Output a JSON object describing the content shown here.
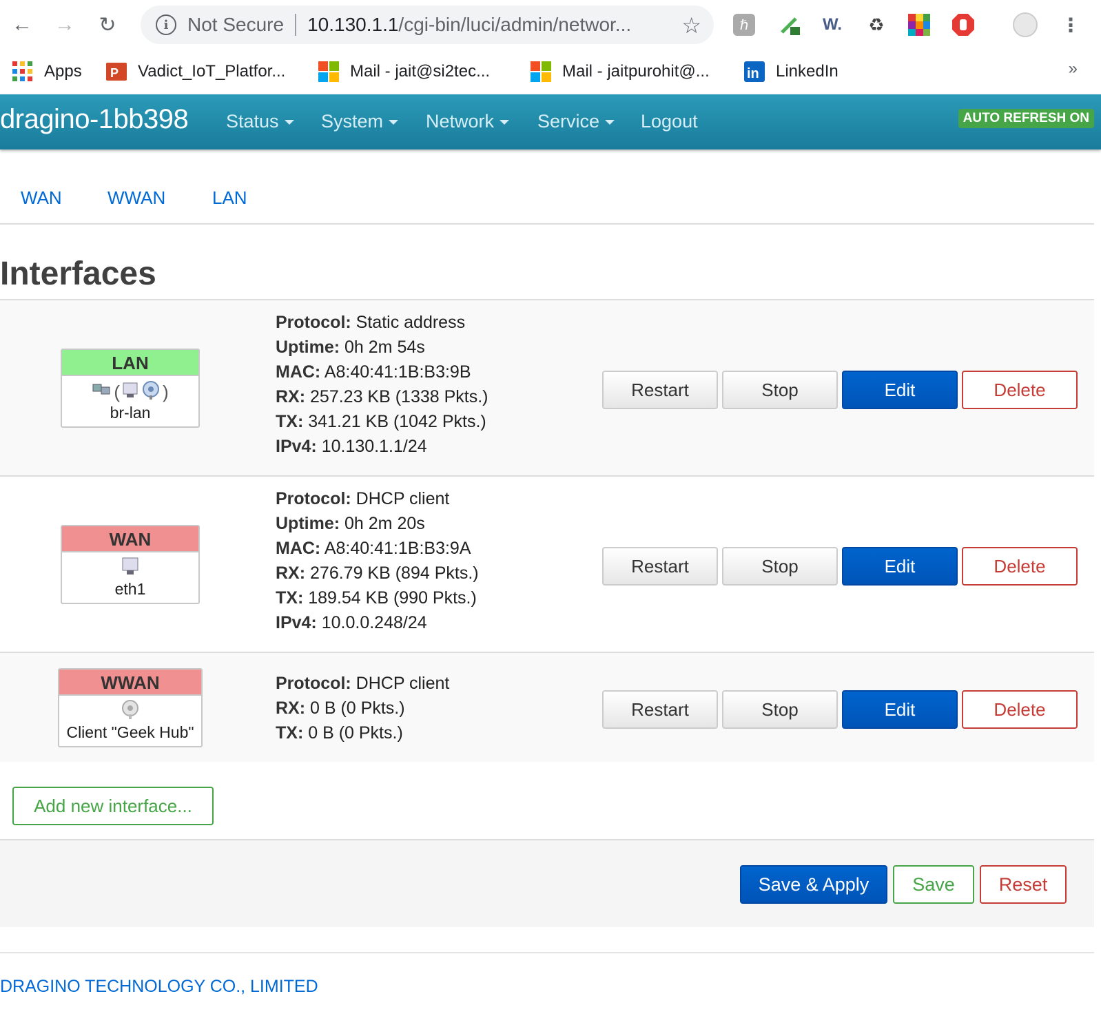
{
  "browser": {
    "url_security": "Not Secure",
    "url_host": "10.130.1.1",
    "url_path": "/cgi-bin/luci/admin/networ...",
    "bookmarks": [
      {
        "label": "Apps",
        "icon": "apps-grid-icon"
      },
      {
        "label": "Vadict_IoT_Platfor...",
        "icon": "powerpoint-icon"
      },
      {
        "label": "Mail - jait@si2tec...",
        "icon": "microsoft-icon"
      },
      {
        "label": "Mail - jaitpurohit@...",
        "icon": "microsoft-icon"
      },
      {
        "label": "LinkedIn",
        "icon": "linkedin-icon"
      }
    ],
    "more_bookmarks": "»",
    "extension_w_label": "W."
  },
  "header": {
    "brand": "dragino-1bb398",
    "menu": [
      "Status",
      "System",
      "Network",
      "Service",
      "Logout"
    ],
    "auto_refresh": "AUTO REFRESH ON",
    "colors": {
      "header": "#1f88a8",
      "auto_refresh": "#46a546"
    }
  },
  "tabs": [
    "WAN",
    "WWAN",
    "LAN"
  ],
  "page_title": "Interfaces",
  "interfaces": [
    {
      "name": "LAN",
      "status": "up",
      "device": "br-lan",
      "details": [
        {
          "k": "Protocol:",
          "v": "Static address"
        },
        {
          "k": "Uptime:",
          "v": "0h 2m 54s"
        },
        {
          "k": "MAC:",
          "v": "A8:40:41:1B:B3:9B"
        },
        {
          "k": "RX:",
          "v": "257.23 KB (1338 Pkts.)"
        },
        {
          "k": "TX:",
          "v": "341.21 KB (1042 Pkts.)"
        },
        {
          "k": "IPv4:",
          "v": "10.130.1.1/24"
        }
      ]
    },
    {
      "name": "WAN",
      "status": "down",
      "device": "eth1",
      "details": [
        {
          "k": "Protocol:",
          "v": "DHCP client"
        },
        {
          "k": "Uptime:",
          "v": "0h 2m 20s"
        },
        {
          "k": "MAC:",
          "v": "A8:40:41:1B:B3:9A"
        },
        {
          "k": "RX:",
          "v": "276.79 KB (894 Pkts.)"
        },
        {
          "k": "TX:",
          "v": "189.54 KB (990 Pkts.)"
        },
        {
          "k": "IPv4:",
          "v": "10.0.0.248/24"
        }
      ]
    },
    {
      "name": "WWAN",
      "status": "down",
      "device": "Client \"Geek Hub\"",
      "details": [
        {
          "k": "Protocol:",
          "v": "DHCP client"
        },
        {
          "k": "RX:",
          "v": "0 B (0 Pkts.)"
        },
        {
          "k": "TX:",
          "v": "0 B (0 Pkts.)"
        }
      ]
    }
  ],
  "row_buttons": {
    "restart": "Restart",
    "stop": "Stop",
    "edit": "Edit",
    "delete": "Delete"
  },
  "add_interface": "Add new interface...",
  "actions": {
    "save_apply": "Save & Apply",
    "save": "Save",
    "reset": "Reset"
  },
  "footer": "DRAGINO TECHNOLOGY CO., LIMITED"
}
